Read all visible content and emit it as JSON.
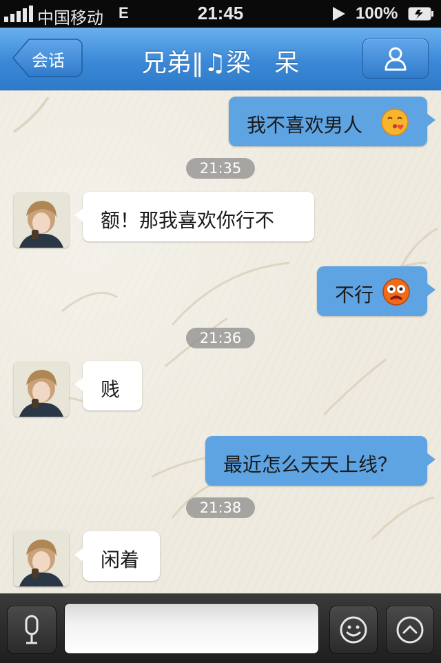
{
  "status_bar": {
    "carrier": "中国移动",
    "network": "E",
    "time": "21:45",
    "battery": "100%",
    "icons": [
      "signal-icon",
      "play-icon",
      "battery-icon"
    ]
  },
  "nav": {
    "back_label": "会话",
    "title": "兄弟‖♫梁   呆",
    "profile_icon": "person-icon"
  },
  "messages": [
    {
      "side": "right",
      "text": "我不喜欢男人",
      "emoji": "kiss-emoji-icon"
    },
    {
      "type": "timestamp",
      "text": "21:35"
    },
    {
      "side": "left",
      "text": "额！那我喜欢你行不"
    },
    {
      "side": "right",
      "text": "不行",
      "emoji": "angry-emoji-icon"
    },
    {
      "type": "timestamp",
      "text": "21:36"
    },
    {
      "side": "left",
      "text": "贱"
    },
    {
      "side": "right",
      "text": "最近怎么天天上线？"
    },
    {
      "type": "timestamp",
      "text": "21:38"
    },
    {
      "side": "left",
      "text": "闲着"
    }
  ],
  "input_bar": {
    "voice_icon": "microphone-icon",
    "emoji_icon": "smiley-icon",
    "more_icon": "chevron-up-icon",
    "input_value": ""
  },
  "colors": {
    "nav_blue": "#3a88d6",
    "bubble_right": "#5ea4e3",
    "bubble_left": "#ffffff",
    "chat_bg": "#eeeadf"
  }
}
